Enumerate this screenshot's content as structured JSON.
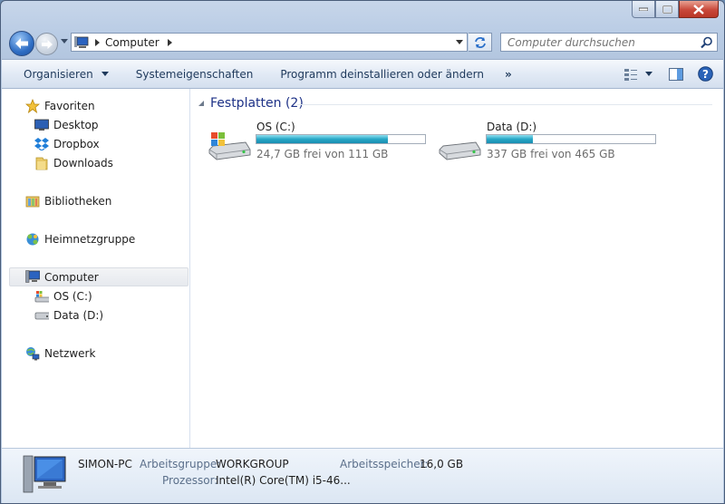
{
  "window": {
    "controls": {
      "minimize": "—",
      "maximize": "☐",
      "close": "✕"
    }
  },
  "address": {
    "crumb": "Computer"
  },
  "search": {
    "placeholder": "Computer durchsuchen"
  },
  "toolbar": {
    "organize": "Organisieren",
    "system_properties": "Systemeigenschaften",
    "uninstall": "Programm deinstallieren oder ändern",
    "more": "»"
  },
  "sidebar": {
    "favorites": "Favoriten",
    "desktop": "Desktop",
    "dropbox": "Dropbox",
    "downloads": "Downloads",
    "libraries": "Bibliotheken",
    "homegroup": "Heimnetzgruppe",
    "computer": "Computer",
    "drive_c": "OS (C:)",
    "drive_d": "Data (D:)",
    "network": "Netzwerk"
  },
  "content": {
    "group_title": "Festplatten (2)",
    "drives": [
      {
        "label": "OS (C:)",
        "free_text": "24,7 GB frei von 111 GB",
        "used_fraction": 0.78
      },
      {
        "label": "Data (D:)",
        "free_text": "337 GB frei von 465 GB",
        "used_fraction": 0.275
      }
    ]
  },
  "details": {
    "pc_name": "SIMON-PC",
    "workgroup_label": "Arbeitsgruppe:",
    "workgroup_value": "WORKGROUP",
    "memory_label": "Arbeitsspeicher:",
    "memory_value": "16,0 GB",
    "cpu_label": "Prozessor:",
    "cpu_value": "Intel(R) Core(TM) i5-46..."
  },
  "colors": {
    "accent": "#1e3287",
    "bar_fill": "#27a7c6"
  }
}
